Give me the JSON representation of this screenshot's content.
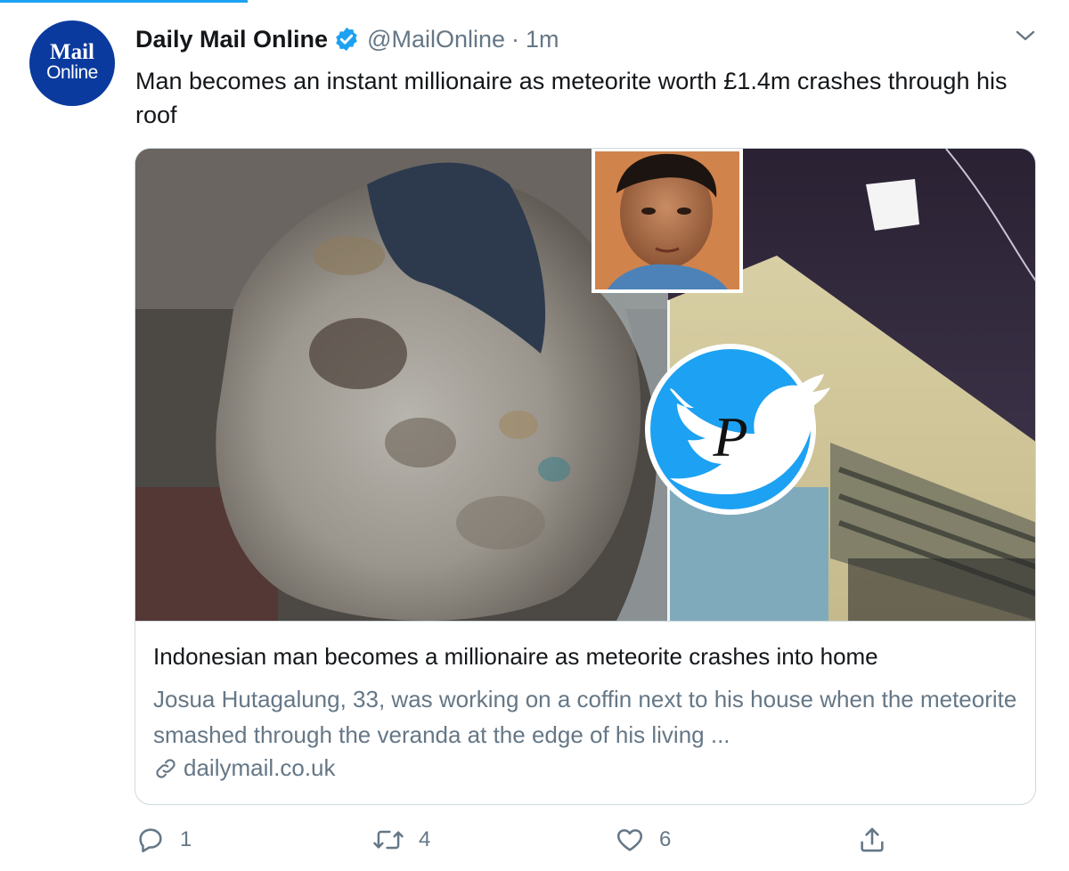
{
  "account": {
    "avatar_line1": "Mail",
    "avatar_line2": "Online",
    "name": "Daily Mail Online",
    "handle": "@MailOnline",
    "separator": "·",
    "time": "1m"
  },
  "tweet": {
    "text": "Man becomes an instant millionaire as meteorite worth £1.4m crashes through his roof"
  },
  "card": {
    "title": "Indonesian man becomes a millionaire as meteorite crashes into home",
    "description": "Josua Hutagalung, 33, was working on a coffin next to his house when the meteorite smashed through the veranda at the edge of his living ...",
    "domain": "dailymail.co.uk",
    "watermark_letter": "P"
  },
  "actions": {
    "reply_count": "1",
    "retweet_count": "4",
    "like_count": "6"
  },
  "icons": [
    "verified-badge-icon",
    "chevron-down-icon",
    "link-icon",
    "reply-icon",
    "retweet-icon",
    "like-icon",
    "share-icon",
    "twitter-bird-icon"
  ],
  "colors": {
    "accent": "#1da1f2",
    "avatar_bg": "#0b3a9e",
    "secondary_text": "#657786",
    "border": "#cfd9de"
  }
}
